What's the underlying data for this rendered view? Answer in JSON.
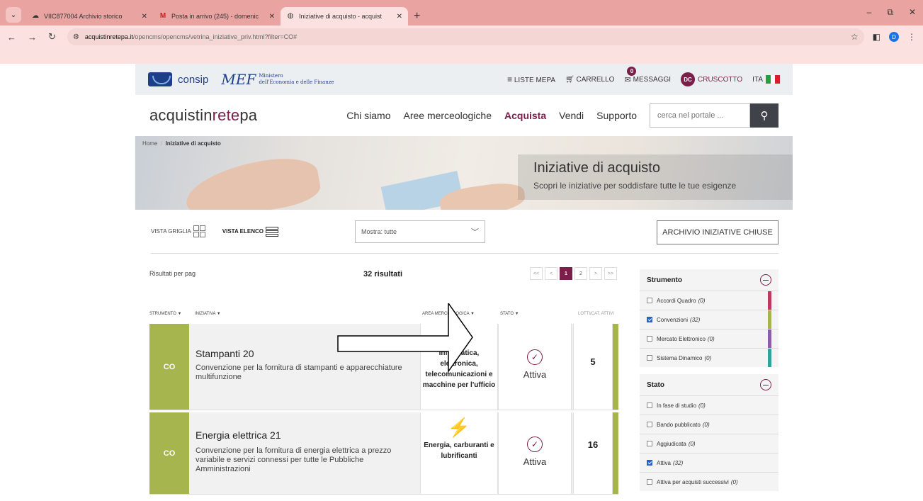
{
  "browser": {
    "tabs": [
      {
        "title": "VIIC877004 Archivio storico",
        "icon": "cloud-icon"
      },
      {
        "title": "Posta in arrivo (245) - domenic",
        "icon": "gmail-icon"
      },
      {
        "title": "Iniziative di acquisto - acquist",
        "icon": "globe-icon"
      }
    ],
    "url_domain": "acquistinretepa.it",
    "url_path": "/opencms/opencms/vetrina_iniziative_priv.html?filter=CO#",
    "profile_initial": "D"
  },
  "topbar": {
    "consip": "consip",
    "mef": "MEF",
    "mef_sub1": "Ministero",
    "mef_sub2": "dell'Economia e delle Finanze",
    "liste": "LISTE MEPA",
    "carrello": "CARRELLO",
    "msg_count": "0",
    "messaggi": "MESSAGGI",
    "dc": "DC",
    "cruscotto": "CRUSCOTTO",
    "lang": "ITA"
  },
  "mainbar": {
    "logo_a": "acquistin",
    "logo_b": "rete",
    "logo_c": "pa",
    "menu": [
      "Chi siamo",
      "Aree merceologiche",
      "Acquista",
      "Vendi",
      "Supporto"
    ],
    "search_placeholder": "cerca nel portale ..."
  },
  "hero": {
    "breadcrumb_home": "Home",
    "breadcrumb_sep": "/",
    "breadcrumb_current": "Iniziative di acquisto",
    "title": "Iniziative di acquisto",
    "subtitle": "Scopri le iniziative per soddisfare tutte le tue esigenze"
  },
  "toolbar": {
    "vista_griglia": "VISTA GRIGLIA",
    "vista_elenco": "VISTA ELENCO",
    "mostra": "Mostra: tutte",
    "archivio": "ARCHIVIO INIZIATIVE CHIUSE"
  },
  "results": {
    "per_page_label": "Risultati per pag",
    "count": "32 risultati",
    "pager": [
      "<<",
      "<",
      "1",
      "2",
      ">",
      ">>"
    ]
  },
  "table_headers": {
    "strumento": "STRUMENTO ▼",
    "iniziativa": "INIZIATIVA ▼",
    "area": "AREA MERCEOLOGICA ▼",
    "stato": "STATO ▼",
    "lotti": "LOTTI/CAT. ATTIVI"
  },
  "rows": [
    {
      "code": "CO",
      "title": "Stampanti 20",
      "desc": "Convenzione per la fornitura di stampanti e apparecchiature multifunzione",
      "area": "Informatica, elettronica, telecomunicazioni e macchine per l'ufficio",
      "stato": "Attiva",
      "lotti": "5"
    },
    {
      "code": "CO",
      "title": "Energia elettrica 21",
      "desc": "Convenzione per la fornitura di energia elettrica a prezzo variabile e servizi connessi per tutte le Pubbliche Amministrazioni",
      "area": "Energia, carburanti e lubrificanti",
      "stato": "Attiva",
      "lotti": "16"
    }
  ],
  "filters": {
    "strumento_title": "Strumento",
    "strumento": [
      {
        "label": "Accordi Quadro",
        "count": "(0)",
        "color": "#c0395f"
      },
      {
        "label": "Convenzioni",
        "count": "(32)",
        "color": "#a7b54e"
      },
      {
        "label": "Mercato Elettronico",
        "count": "(0)",
        "color": "#8e5da8"
      },
      {
        "label": "Sistema Dinamico",
        "count": "(0)",
        "color": "#2fa39c"
      }
    ],
    "stato_title": "Stato",
    "stato": [
      {
        "label": "In fase di studio",
        "count": "(0)"
      },
      {
        "label": "Bando pubblicato",
        "count": "(0)"
      },
      {
        "label": "Aggiudicata",
        "count": "(0)"
      },
      {
        "label": "Attiva",
        "count": "(32)"
      },
      {
        "label": "Attiva per acquisti successivi",
        "count": "(0)"
      }
    ]
  },
  "colors": {
    "brand": "#7a1e4a",
    "convenzione": "#a7b54e"
  }
}
